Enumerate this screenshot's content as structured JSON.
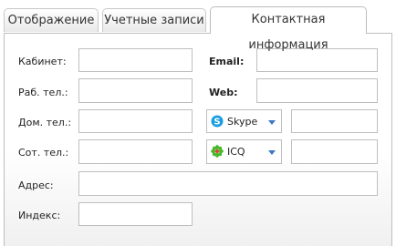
{
  "tabs": [
    {
      "label": "Отображение"
    },
    {
      "label": "Учетные записи"
    },
    {
      "label": "Контактная информация"
    }
  ],
  "active_tab": "Контактная информация",
  "form": {
    "cabinet_label": "Кабинет:",
    "work_phone_label": "Раб. тел.:",
    "home_phone_label": "Дом. тел.:",
    "mobile_phone_label": "Сот. тел.:",
    "address_label": "Адрес:",
    "index_label": "Индекс:",
    "email_label": "Email:",
    "web_label": "Web:",
    "messenger1": {
      "selected": "Skype",
      "icon": "skype-icon"
    },
    "messenger2": {
      "selected": "ICQ",
      "icon": "icq-icon"
    },
    "values": {
      "cabinet": "",
      "work_phone": "",
      "home_phone": "",
      "mobile_phone": "",
      "address": "",
      "index": "",
      "email": "",
      "web": "",
      "skype_id": "",
      "icq_id": ""
    }
  },
  "colors": {
    "skype": "#1a9ee0",
    "icq_flower": "#47b82c",
    "icq_center": "#e23a2a",
    "dropdown_arrow": "#3a77c5"
  }
}
